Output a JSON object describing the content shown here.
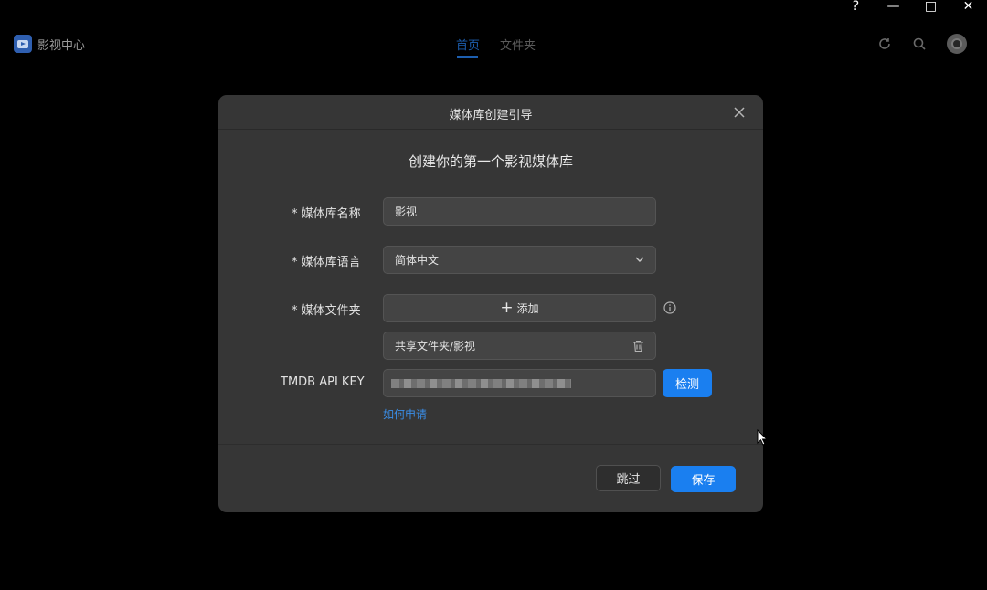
{
  "window": {
    "help": "?",
    "minimize": "—",
    "maximize": "□",
    "close": "✕"
  },
  "app": {
    "name": "影视中心"
  },
  "nav": {
    "tabs": [
      {
        "label": "首页",
        "active": true
      },
      {
        "label": "文件夹",
        "active": false
      }
    ]
  },
  "dialog": {
    "title": "媒体库创建引导",
    "heading": "创建你的第一个影视媒体库",
    "fields": {
      "name": {
        "label": "* 媒体库名称",
        "value": "影视"
      },
      "language": {
        "label": "* 媒体库语言",
        "value": "简体中文"
      },
      "folder": {
        "label": "* 媒体文件夹",
        "add_label": "添加",
        "items": [
          "共享文件夹/影视"
        ]
      },
      "api": {
        "label": "TMDB API KEY",
        "check_label": "检测",
        "help_link": "如何申请"
      }
    },
    "buttons": {
      "skip": "跳过",
      "save": "保存"
    }
  },
  "colors": {
    "accent": "#1a7ff0",
    "link": "#3a8ee8",
    "dialog_bg": "#363636",
    "page_bg": "#000000"
  }
}
